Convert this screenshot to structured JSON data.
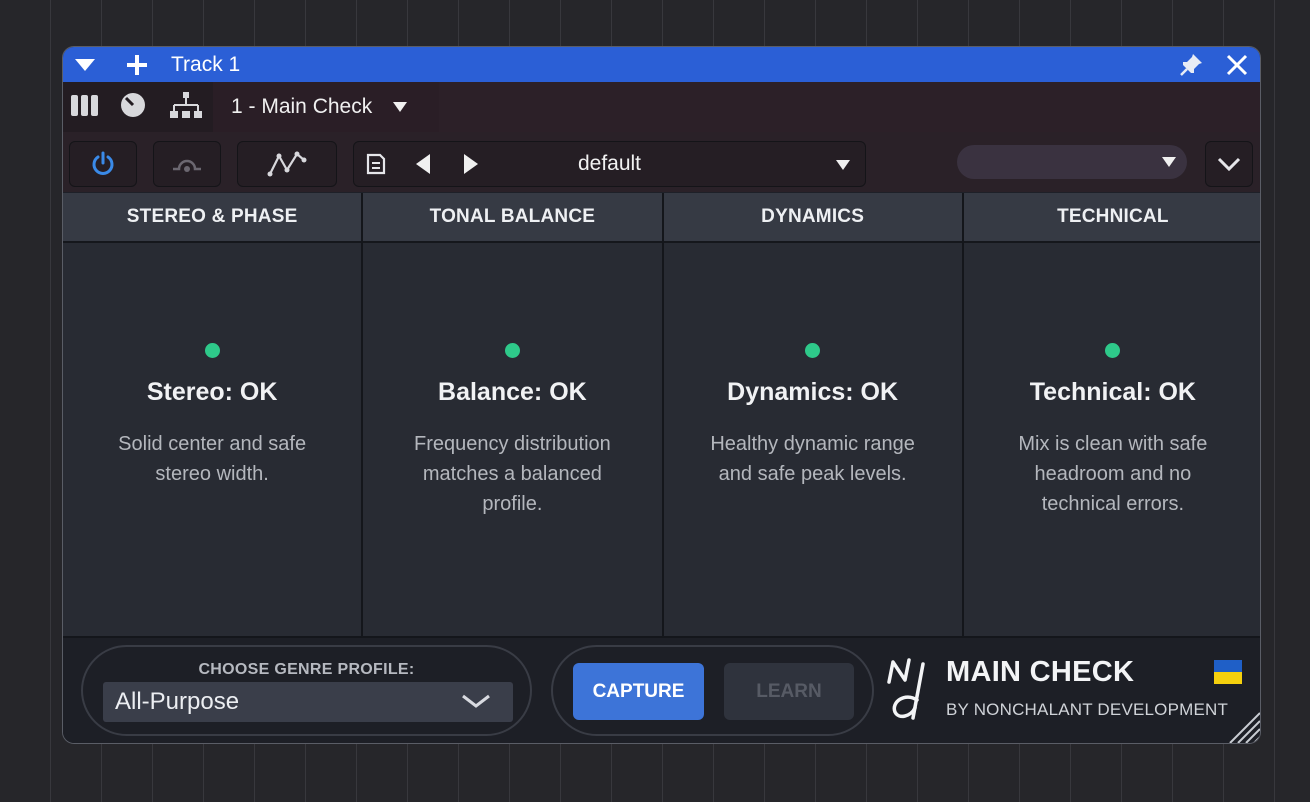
{
  "titlebar": {
    "title": "Track 1",
    "icons": [
      "chevron-down-icon",
      "plus-icon",
      "pin-icon",
      "close-icon"
    ]
  },
  "toolbar": {
    "preset_tab": "1 - Main Check",
    "preset_name": "default",
    "icons": [
      "meter-bars-icon",
      "knob-icon",
      "routing-icon",
      "power-icon",
      "bypass-icon",
      "automation-icon",
      "save-icon",
      "prev-icon",
      "next-icon"
    ]
  },
  "columns": [
    {
      "header": "STEREO & PHASE",
      "status": "Stereo: OK",
      "description": "Solid center and safe stereo width."
    },
    {
      "header": "TONAL BALANCE",
      "status": "Balance: OK",
      "description": "Frequency distribution matches a balanced profile."
    },
    {
      "header": "DYNAMICS",
      "status": "Dynamics: OK",
      "description": "Healthy dynamic range and safe peak levels."
    },
    {
      "header": "TECHNICAL",
      "status": "Technical: OK",
      "description": "Mix is clean with safe headroom and no technical errors."
    }
  ],
  "footer": {
    "genre_label": "CHOOSE GENRE PROFILE:",
    "genre_value": "All-Purpose",
    "capture_label": "CAPTURE",
    "learn_label": "LEARN",
    "brand_title": "MAIN CHECK",
    "brand_sub": "BY NONCHALANT DEVELOPMENT"
  },
  "colors": {
    "titlebar": "#2b5fd6",
    "status_ok": "#2ec98a",
    "capture": "#3d74d8",
    "flag_blue": "#1f5fc7",
    "flag_yellow": "#f5d00e"
  }
}
